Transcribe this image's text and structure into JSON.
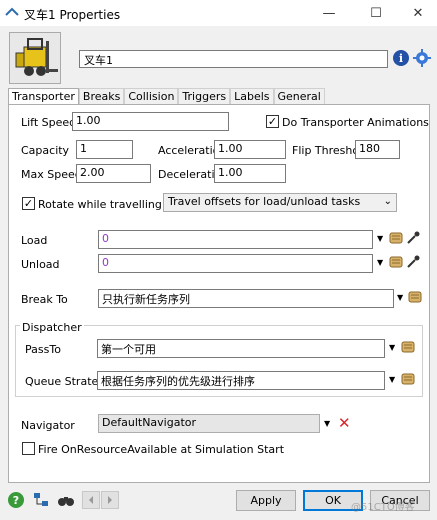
{
  "window": {
    "title": "叉车1  Properties",
    "minimize": "—",
    "maximize": "☐",
    "close": "✕"
  },
  "header": {
    "object_name": "叉车1"
  },
  "tabs": [
    "Transporter",
    "Breaks",
    "Collision",
    "Triggers",
    "Labels",
    "General"
  ],
  "transporter": {
    "lift_speed_label": "Lift Speed",
    "lift_speed": "1.00",
    "animations_label": "Do Transporter Animations",
    "capacity_label": "Capacity",
    "capacity": "1",
    "acceleration_label": "Acceleration",
    "acceleration": "1.00",
    "flip_label": "Flip Threshold",
    "flip": "180",
    "max_speed_label": "Max Speed",
    "max_speed": "2.00",
    "deceleration_label": "Deceleration",
    "deceleration": "1.00",
    "rotate_label": "Rotate while travelling",
    "travel_offsets": "Travel offsets for load/unload tasks",
    "load_label": "Load",
    "load_value": "0",
    "unload_label": "Unload",
    "unload_value": "0",
    "break_to_label": "Break To",
    "break_to_value": "只执行新任务序列",
    "dispatcher_label": "Dispatcher",
    "pass_to_label": "PassTo",
    "pass_to_value": "第一个可用",
    "queue_label": "Queue Strategy",
    "queue_value": "根据任务序列的优先级进行排序",
    "navigator_label": "Navigator",
    "navigator_value": "DefaultNavigator",
    "fire_label": "Fire OnResourceAvailable at Simulation Start"
  },
  "footer": {
    "apply": "Apply",
    "ok": "OK",
    "cancel": "Cancel",
    "watermark": "@51CTO博客"
  },
  "colors": {
    "accent": "#0078d7",
    "delete": "#d9262c",
    "info": "#2251a6",
    "help": "#3a9a3a"
  }
}
